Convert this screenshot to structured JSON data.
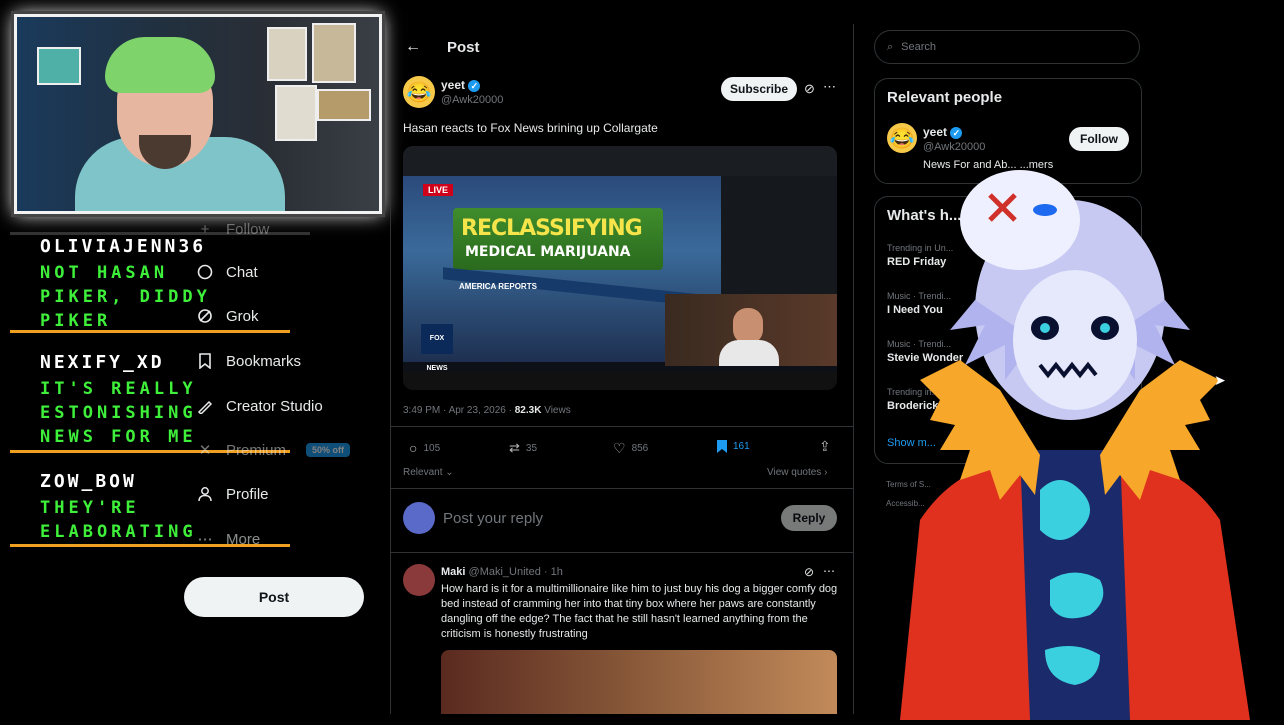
{
  "webcam": {
    "label": "streamer webcam"
  },
  "chat": [
    {
      "user": "OLIVIAJENN36",
      "lines": [
        "NOT HASAN",
        "PIKER, DIDDY",
        "PIKER"
      ]
    },
    {
      "user": "NEXIFY_XD",
      "lines": [
        "IT'S REALLY",
        "ESTONISHING",
        "NEWS FOR ME"
      ]
    },
    {
      "user": "ZOW_BOW",
      "lines": [
        "THEY'RE",
        "ELABORATING"
      ]
    }
  ],
  "sidebar": {
    "items": [
      {
        "label": "Follow",
        "icon": "follow-icon"
      },
      {
        "label": "Chat",
        "icon": "chat-icon"
      },
      {
        "label": "Grok",
        "icon": "grok-icon"
      },
      {
        "label": "Bookmarks",
        "icon": "bookmark-icon"
      },
      {
        "label": "Creator Studio",
        "icon": "creator-studio-icon"
      },
      {
        "label": "Premium",
        "icon": "x-icon",
        "badge": "50% off"
      },
      {
        "label": "Profile",
        "icon": "profile-icon"
      },
      {
        "label": "More",
        "icon": "more-icon"
      }
    ],
    "post_button": "Post"
  },
  "post": {
    "header_title": "Post",
    "author_name": "yeet",
    "author_handle": "@Awk20000",
    "subscribe_label": "Subscribe",
    "text": "Hasan reacts to Fox News brining up Collargate",
    "video": {
      "banner_text_1": "RECLASSIFYING",
      "banner_text_2": "MEDICAL MARIJUANA",
      "live_badge": "LIVE",
      "lower_third": "AMERICA REPORTS",
      "network": "FOX NEWS"
    },
    "timestamp": "3:49 PM · Apr 23, 2026 · ",
    "views_count": "82.3K",
    "views_label": " Views",
    "actions": {
      "replies": "105",
      "reposts": "35",
      "likes": "856",
      "bookmarks": "161"
    },
    "relevant_label": "Relevant ⌄",
    "view_quotes": "View quotes ›",
    "reply_placeholder": "Post your reply",
    "reply_button": "Reply"
  },
  "reply": {
    "author_name": "Maki",
    "author_handle": "@Maki_United",
    "time": "· 1h",
    "text": "How hard is it for a multimillionaire like him to just buy his dog a bigger comfy dog bed instead of cramming her into that tiny box where her paws are constantly dangling off the edge? The fact that he still hasn't learned anything from the criticism is honestly frustrating"
  },
  "right": {
    "search_placeholder": "Search",
    "relevant_title": "Relevant people",
    "person_name": "yeet",
    "person_handle": "@Awk20000",
    "person_bio": "News For and Ab... ...mers",
    "follow_label": "Follow",
    "trends_title": "What's h...",
    "trends": [
      {
        "context": "Trending in Un...",
        "name": "RED Friday"
      },
      {
        "context": "Music · Trendi...",
        "name": "I Need You"
      },
      {
        "context": "Music · Trendi...",
        "name": "Stevie Wonder"
      },
      {
        "context": "Trending in...",
        "name": "Broderick..."
      }
    ],
    "show_more": "Show m...",
    "footer_1": "Terms of S...",
    "footer_2": "Accessib..."
  },
  "colors": {
    "accent": "#1d9bf0",
    "chat_green": "#3ef03a",
    "chat_bar": "#f0a020",
    "premium_badge": "#1d9bf0"
  }
}
